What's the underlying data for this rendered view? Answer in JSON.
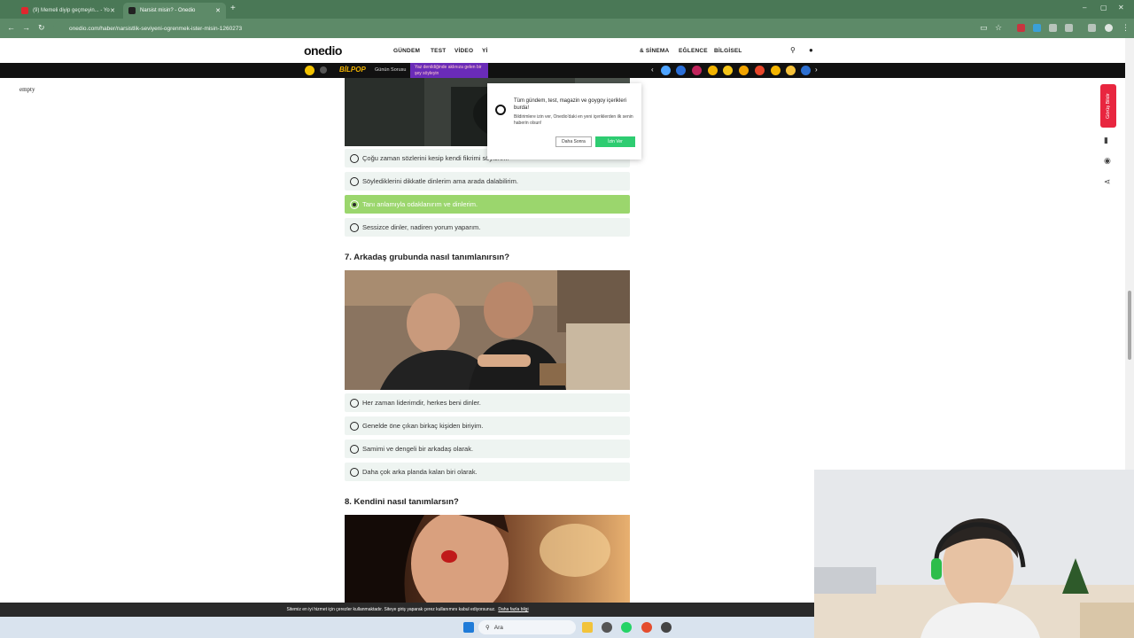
{
  "browser": {
    "tabs": [
      {
        "title": "(9) Memeli diyip geçmeyin... - Yo",
        "active": false
      },
      {
        "title": "Narsist misin? - Onedio",
        "active": true
      }
    ],
    "url": "onedio.com/haber/narsistlik-seviyeni-ogrenmek-ister-misin-1260273"
  },
  "site": {
    "logo": "onedio",
    "nav": [
      "GÜNDEM",
      "TEST",
      "VİDEO",
      "Yİ",
      "& SİNEMA",
      "EĞLENCE",
      "BİLGİSEL"
    ],
    "subbar": {
      "bilpop": "BİLPOP",
      "gunun_sorusu": "Günün Sorusu",
      "promo": "Yaz denildiğinde aklınıza gelen bir şey söyleyin"
    }
  },
  "left_text": "empty",
  "question6": {
    "options": [
      {
        "text": "Çoğu zaman sözlerini kesip kendi fikrimi söylerim.",
        "selected": false
      },
      {
        "text": "Söylediklerini dikkatle dinlerim ama arada dalabilirim.",
        "selected": false
      },
      {
        "text": "Tanı anlamıyla odaklanırım ve dinlerim.",
        "selected": true
      },
      {
        "text": "Sessizce dinler, nadiren yorum yaparım.",
        "selected": false
      }
    ]
  },
  "question7": {
    "title": "7. Arkadaş grubunda nasıl tanımlanırsın?",
    "options": [
      {
        "text": "Her zaman liderimdir, herkes beni dinler.",
        "selected": false
      },
      {
        "text": "Genelde öne çıkan birkaç kişiden biriyim.",
        "selected": false
      },
      {
        "text": "Samimi ve dengeli bir arkadaş olarak.",
        "selected": false
      },
      {
        "text": "Daha çok arka planda kalan biri olarak.",
        "selected": false
      }
    ]
  },
  "question8": {
    "title": "8. Kendini nasıl tanımlarsın?"
  },
  "notification": {
    "title": "Tüm gündem, test, magazin ve goygoy içerikleri burda!",
    "body": "Bildirimlere izin ver, Onedio'daki en yeni içeriklerden ilk senin haberin olsun!",
    "later_label": "Daha Sonra",
    "allow_label": "İzin Ver"
  },
  "feedback_label": "Görüş Bildir",
  "cookie": {
    "text": "Sitemiz en iyi hizmet için çerezler kullanmaktadır. Siteye giriş yaparak çerez kullanımını kabul ediyorsunuz.",
    "link": "Daha fazla bilgi"
  },
  "taskbar": {
    "search_placeholder": "Ara"
  },
  "colors": {
    "browser_frame": "#4a7856",
    "selected_option": "#9bd66d",
    "option_bg": "#eef4f1",
    "allow_button": "#2ecc71",
    "feedback_tab": "#e8263f"
  }
}
